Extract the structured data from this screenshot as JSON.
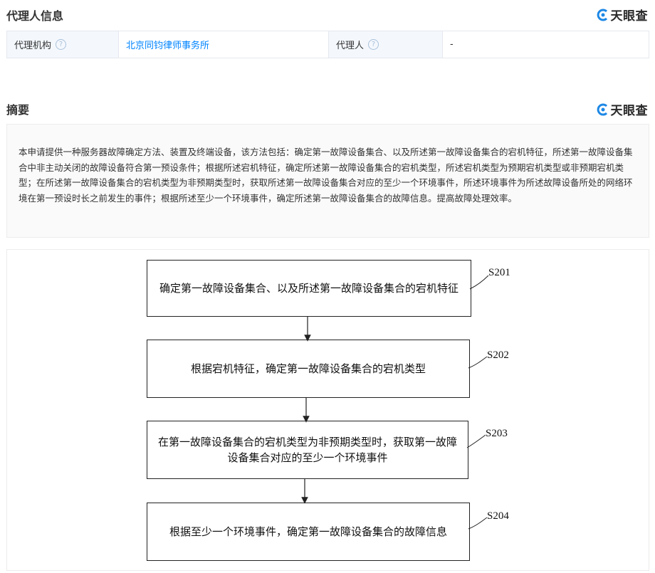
{
  "agent_section": {
    "title": "代理人信息",
    "brand": "天眼查",
    "agency_label": "代理机构",
    "agency_value": "北京同钧律师事务所",
    "agent_label": "代理人",
    "agent_value": "-"
  },
  "abstract_section": {
    "title": "摘要",
    "brand": "天眼查",
    "text": "本申请提供一种服务器故障确定方法、装置及终端设备，该方法包括：确定第一故障设备集合、以及所述第一故障设备集合的宕机特征，所述第一故障设备集合中非主动关闭的故障设备符合第一预设条件；根据所述宕机特征，确定所述第一故障设备集合的宕机类型，所述宕机类型为预期宕机类型或非预期宕机类型；在所述第一故障设备集合的宕机类型为非预期类型时，获取所述第一故障设备集合对应的至少一个环境事件，所述环境事件为所述故障设备所处的网络环境在第一预设时长之前发生的事件；根据所述至少一个环境事件，确定所述第一故障设备集合的故障信息。提高故障处理效率。"
  },
  "flowchart": {
    "steps": [
      {
        "id": "S201",
        "text": "确定第一故障设备集合、以及所述第一故障设备集合的宕机特征"
      },
      {
        "id": "S202",
        "text": "根据宕机特征，确定第一故障设备集合的宕机类型"
      },
      {
        "id": "S203",
        "text": "在第一故障设备集合的宕机类型为非预期类型时，获取第一故障设备集合对应的至少一个环境事件"
      },
      {
        "id": "S204",
        "text": "根据至少一个环境事件，确定第一故障设备集合的故障信息"
      }
    ]
  }
}
